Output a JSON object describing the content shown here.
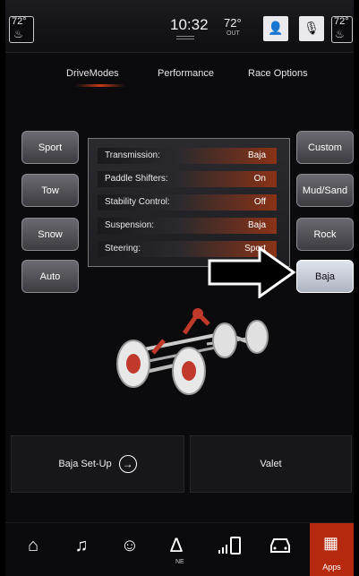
{
  "status": {
    "driver_temp": "72°",
    "time": "10:32",
    "outside_temp": "72°",
    "outside_label": "OUT",
    "passenger_temp": "72°"
  },
  "tabs": [
    "DriveModes",
    "Performance",
    "Race Options"
  ],
  "modes_left": [
    "Sport",
    "Tow",
    "Snow",
    "Auto"
  ],
  "modes_right": [
    "Custom",
    "Mud/Sand",
    "Rock",
    "Baja"
  ],
  "selected_mode": "Baja",
  "settings": [
    {
      "label": "Transmission:",
      "value": "Baja"
    },
    {
      "label": "Paddle Shifters:",
      "value": "On"
    },
    {
      "label": "Stability Control:",
      "value": "Off"
    },
    {
      "label": "Suspension:",
      "value": "Baja"
    },
    {
      "label": "Steering:",
      "value": "Sport"
    }
  ],
  "bottom_buttons": {
    "setup": "Baja Set-Up",
    "valet": "Valet"
  },
  "nav": {
    "compass_label": "NE",
    "apps_label": "Apps"
  },
  "colors": {
    "accent": "#b52a0e",
    "panel_highlight": "#8a3216"
  }
}
